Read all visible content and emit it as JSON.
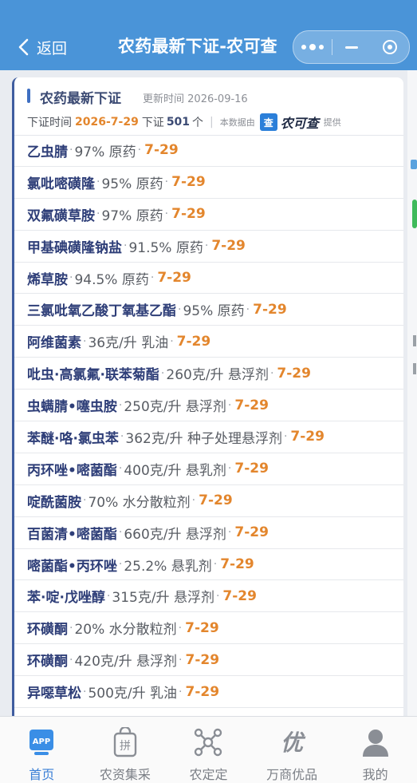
{
  "header": {
    "back_label": "返回",
    "title": "农药最新下证-农可查"
  },
  "card": {
    "section_title": "农药最新下证",
    "updated_label": "更新时间",
    "updated_date": "2026-09-16",
    "cert_time_label": "下证时间",
    "cert_date": "2026-7-29",
    "cert_count_label": "下证",
    "cert_count": "501",
    "cert_unit": "个",
    "source_label": "本数据由",
    "brand_icon_char": "查",
    "brand_name": "农可查",
    "provide_label": "提供"
  },
  "items": [
    {
      "name": "乙虫腈",
      "spec": "97% 原药",
      "date": "7-29"
    },
    {
      "name": "氯吡嘧磺隆",
      "spec": "95% 原药",
      "date": "7-29"
    },
    {
      "name": "双氟磺草胺",
      "spec": "97% 原药",
      "date": "7-29"
    },
    {
      "name": "甲基碘磺隆钠盐",
      "spec": "91.5% 原药",
      "date": "7-29"
    },
    {
      "name": "烯草胺",
      "spec": "94.5% 原药",
      "date": "7-29"
    },
    {
      "name": "三氯吡氧乙酸丁氧基乙酯",
      "spec": "95% 原药",
      "date": "7-29"
    },
    {
      "name": "阿维菌素",
      "spec": "36克/升 乳油",
      "date": "7-29"
    },
    {
      "name": "吡虫·高氯氟·联苯菊酯",
      "spec": "260克/升 悬浮剂",
      "date": "7-29"
    },
    {
      "name": "虫螨腈•噻虫胺",
      "spec": "250克/升 悬浮剂",
      "date": "7-29"
    },
    {
      "name": "苯醚·咯·氯虫苯",
      "spec": "362克/升 种子处理悬浮剂",
      "date": "7-29"
    },
    {
      "name": "丙环唑•嘧菌酯",
      "spec": "400克/升 悬乳剂",
      "date": "7-29"
    },
    {
      "name": "啶酰菌胺",
      "spec": "70% 水分散粒剂",
      "date": "7-29"
    },
    {
      "name": "百菌清•嘧菌酯",
      "spec": "660克/升 悬浮剂",
      "date": "7-29"
    },
    {
      "name": "嘧菌酯•丙环唑",
      "spec": "25.2% 悬乳剂",
      "date": "7-29"
    },
    {
      "name": "苯·啶·戊唑醇",
      "spec": "315克/升 悬浮剂",
      "date": "7-29"
    },
    {
      "name": "环磺酮",
      "spec": "20% 水分散粒剂",
      "date": "7-29"
    },
    {
      "name": "环磺酮",
      "spec": "420克/升 悬浮剂",
      "date": "7-29"
    },
    {
      "name": "异噁草松",
      "spec": "500克/升 乳油",
      "date": "7-29"
    }
  ],
  "nav": [
    {
      "label": "首页",
      "icon": "app-icon",
      "active": true
    },
    {
      "label": "农资集采",
      "icon": "shopping-bag-icon",
      "active": false
    },
    {
      "label": "农定定",
      "icon": "network-icon",
      "active": false
    },
    {
      "label": "万商优品",
      "icon": "you-icon",
      "active": false
    },
    {
      "label": "我的",
      "icon": "user-icon",
      "active": false
    }
  ],
  "colors": {
    "header_bg": "#4a94d8",
    "accent_orange": "#e3862d",
    "name_blue": "#2e3e78",
    "active_tab": "#3a7fd6"
  }
}
